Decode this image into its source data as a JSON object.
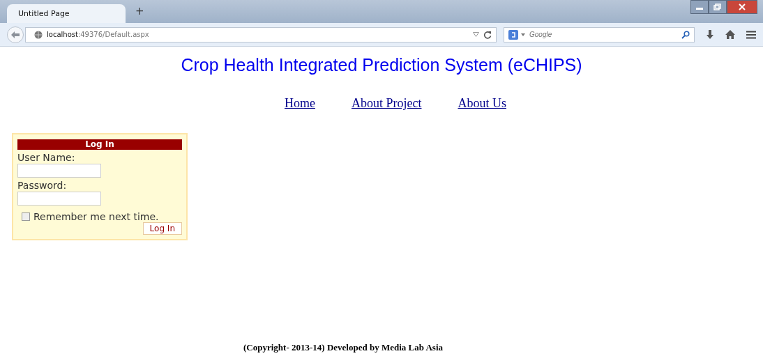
{
  "browser": {
    "tab_title": "Untitled Page",
    "new_tab": "+",
    "address": "**localhost**:49376/Default.aspx",
    "search_placeholder": "Google"
  },
  "page": {
    "title": "Crop Health Integrated Prediction System (eCHIPS)",
    "nav": [
      {
        "label": "Home "
      },
      {
        "label": "About Project"
      },
      {
        "label": "About Us"
      }
    ],
    "login": {
      "heading": "Log In",
      "username_label": "User Name:",
      "password_label": "Password:",
      "remember": {
        "label": "Remember me next time.",
        "checked": false
      },
      "button": "Log In"
    },
    "footer": "(Copyright- 2013-14) Developed by Media Lab Asia"
  }
}
